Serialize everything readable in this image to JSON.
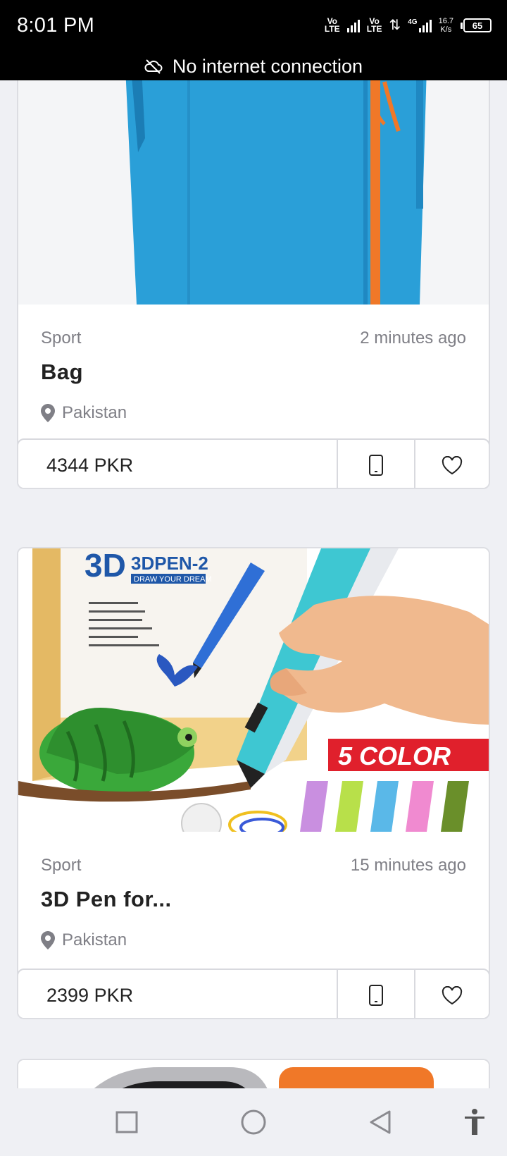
{
  "status_bar": {
    "time": "8:01 PM",
    "sim1": "Vo\nLTE",
    "sim2": "Vo\nLTE",
    "network": "4G",
    "speed_value": "16.7",
    "speed_unit": "K/s",
    "battery": "65",
    "banner": "No internet connection"
  },
  "listings": [
    {
      "category": "Sport",
      "time_ago": "2 minutes ago",
      "title": "Bag",
      "location": "Pakistan",
      "price": "4344 PKR"
    },
    {
      "category": "Sport",
      "time_ago": "15 minutes ago",
      "title": "3D Pen for...",
      "location": "Pakistan",
      "price": "2399 PKR",
      "image_text": {
        "brand_3d": "3D",
        "brand_name": "3DPEN-2",
        "tagline": "DRAW YOUR DREAM",
        "badge": "5 COLOR"
      }
    }
  ],
  "colors": {
    "bag_blue": "#2a9fd8",
    "bag_orange": "#f07828",
    "badge_red": "#e0202c",
    "pen_teal": "#3ec7d2"
  }
}
